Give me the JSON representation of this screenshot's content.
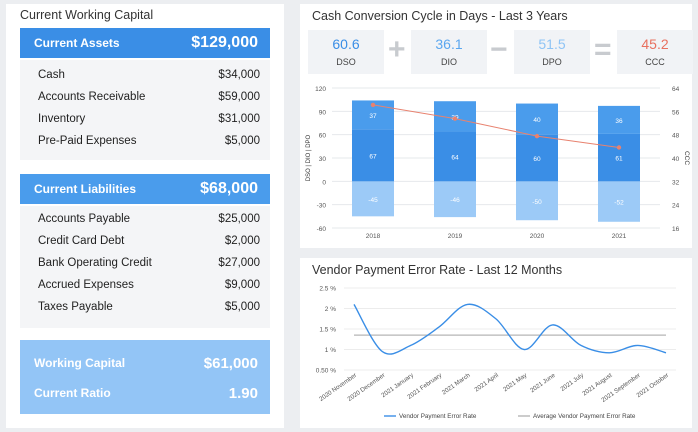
{
  "working_capital": {
    "title": "Current Working Capital",
    "assets": {
      "label": "Current Assets",
      "total": "$129,000",
      "items": [
        {
          "name": "Cash",
          "value": "$34,000"
        },
        {
          "name": "Accounts Receivable",
          "value": "$59,000"
        },
        {
          "name": "Inventory",
          "value": "$31,000"
        },
        {
          "name": "Pre-Paid Expenses",
          "value": "$5,000"
        }
      ]
    },
    "liabilities": {
      "label": "Current Liabilities",
      "total": "$68,000",
      "items": [
        {
          "name": "Accounts Payable",
          "value": "$25,000"
        },
        {
          "name": "Credit Card Debt",
          "value": "$2,000"
        },
        {
          "name": "Bank Operating Credit",
          "value": "$27,000"
        },
        {
          "name": "Accrued Expenses",
          "value": "$9,000"
        },
        {
          "name": "Taxes Payable",
          "value": "$5,000"
        }
      ]
    },
    "summary": {
      "wc_label": "Working Capital",
      "wc_value": "$61,000",
      "ratio_label": "Current Ratio",
      "ratio_value": "1.90"
    }
  },
  "ccc": {
    "title": "Cash Conversion Cycle in Days - Last 3 Years",
    "kpis": {
      "dso": {
        "value": "60.6",
        "label": "DSO",
        "color": "#3a8ee6"
      },
      "dio": {
        "value": "36.1",
        "label": "DIO",
        "color": "#5aa6ef"
      },
      "dpo": {
        "value": "51.5",
        "label": "DPO",
        "color": "#8fc4f5"
      },
      "ccc": {
        "value": "45.2",
        "label": "CCC",
        "color": "#e8705f"
      }
    },
    "operators": {
      "plus": "+",
      "minus": "−",
      "equals": "="
    }
  },
  "vendor": {
    "title": "Vendor Payment Error Rate - Last 12 Months"
  },
  "chart_data": [
    {
      "type": "bar",
      "categories": [
        "2018",
        "2019",
        "2020",
        "2021"
      ],
      "series": [
        {
          "values": [
            -45,
            -46,
            -50,
            -52
          ],
          "color": "#9ccaf7"
        },
        {
          "values": [
            67,
            64,
            60,
            61
          ],
          "color": "#3a8ee6"
        },
        {
          "values": [
            37,
            39,
            40,
            36
          ],
          "color": "#4a9cec"
        }
      ],
      "line_series": {
        "values": [
          58.2,
          53.5,
          47.5,
          43.6
        ],
        "color": "#e8826f",
        "axis": "right"
      },
      "ylabel": "DSO | DIO | DPO",
      "y2label": "CCC",
      "ylim": [
        -60,
        120
      ],
      "yticks": [
        120,
        90,
        60,
        30,
        0,
        -30,
        -60
      ],
      "y2lim": [
        16,
        64
      ],
      "y2ticks": [
        64,
        56,
        48,
        40,
        32,
        24,
        16
      ],
      "grid": true
    },
    {
      "type": "line",
      "categories": [
        "2020 November",
        "2020 December",
        "2021 January",
        "2021 February",
        "2021 March",
        "2021 April",
        "2021 May",
        "2021 June",
        "2021 July",
        "2021 August",
        "2021 September",
        "2021 October"
      ],
      "series": [
        {
          "name": "Vendor Payment Error Rate",
          "values": [
            2.1,
            0.95,
            1.1,
            1.55,
            2.1,
            1.75,
            1.0,
            1.6,
            1.1,
            0.92,
            1.1,
            0.92
          ],
          "color": "#3a8ee6"
        },
        {
          "name": "Average Vendor Payment Error Rate",
          "values": [
            1.35,
            1.35,
            1.35,
            1.35,
            1.35,
            1.35,
            1.35,
            1.35,
            1.35,
            1.35,
            1.35,
            1.35
          ],
          "color": "#b5b5b5"
        }
      ],
      "ytick_labels": [
        "2.5 %",
        "2 %",
        "1.5 %",
        "1 %",
        "0.50 %"
      ],
      "yticks": [
        2.5,
        2,
        1.5,
        1,
        0.5
      ],
      "ylim": [
        0.5,
        2.5
      ],
      "legend": "bottom",
      "grid": true
    }
  ]
}
